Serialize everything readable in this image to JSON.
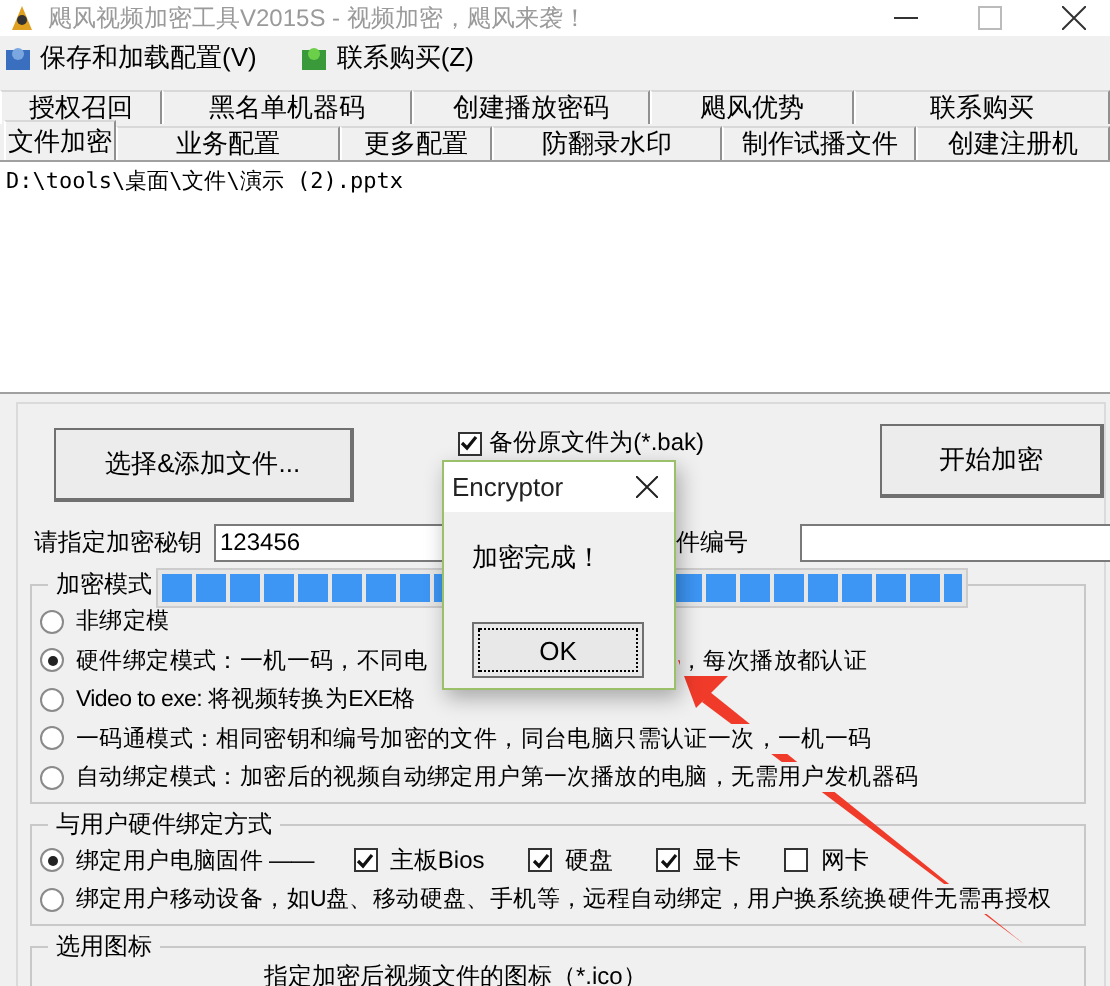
{
  "window": {
    "title": "飓风视频加密工具V2015S - 视频加密，飓风来袭！"
  },
  "menu": [
    {
      "label": "保存和加载配置(V)"
    },
    {
      "label": "联系购买(Z)"
    }
  ],
  "tab_rows": [
    [
      {
        "label": "授权召回",
        "selected": false
      },
      {
        "label": "黑名单机器码",
        "selected": false
      },
      {
        "label": "创建播放密码",
        "selected": false
      },
      {
        "label": "飓风优势",
        "selected": false
      },
      {
        "label": "联系购买",
        "selected": false
      }
    ],
    [
      {
        "label": "文件加密",
        "selected": true
      },
      {
        "label": "业务配置",
        "selected": false
      },
      {
        "label": "更多配置",
        "selected": false
      },
      {
        "label": "防翻录水印",
        "selected": false
      },
      {
        "label": "制作试播文件",
        "selected": false
      },
      {
        "label": "创建注册机",
        "selected": false
      }
    ]
  ],
  "file_list": [
    "D:\\tools\\桌面\\文件\\演示 (2).pptx"
  ],
  "add_button": "选择&添加文件...",
  "backup": {
    "label": "备份原文件为(*.bak)",
    "checked": true
  },
  "start_button": "开始加密",
  "key": {
    "label": "请指定加密秘钥",
    "value": "123456"
  },
  "number": {
    "label": "件编号"
  },
  "mode_group": {
    "title": "加密模式",
    "options": [
      {
        "text": "非绑定模",
        "selected": false
      },
      {
        "text": "硬件绑定模式：一机一码，不同电",
        "tail": "，每次播放都认证",
        "selected": true
      },
      {
        "text": "Video to exe: 将视频转换为EXE格",
        "selected": false
      },
      {
        "text": "一码通模式：相同密钥和编号加密的文件，同台电脑只需认证一次，一机一码",
        "selected": false
      },
      {
        "text": "自动绑定模式：加密后的视频自动绑定用户第一次播放的电脑，无需用户发机器码",
        "selected": false
      }
    ]
  },
  "binding_group": {
    "title": "与用户硬件绑定方式",
    "options": [
      {
        "text": "绑定用户电脑固件 ——",
        "selected": true,
        "parts": [
          {
            "label": "主板Bios",
            "checked": true
          },
          {
            "label": "硬盘",
            "checked": true
          },
          {
            "label": "显卡",
            "checked": true
          },
          {
            "label": "网卡",
            "checked": false
          }
        ]
      },
      {
        "text": "绑定用户移动设备，如U盘、移动硬盘、手机等，远程自动绑定，用户换系统换硬件无需再授权",
        "selected": false
      }
    ]
  },
  "icon_group": {
    "title": "选用图标",
    "hint": "指定加密后视频文件的图标（*.ico）"
  },
  "progress": {
    "level": 1
  },
  "dialog": {
    "title": "Encryptor",
    "message": "加密完成！",
    "button": "OK"
  }
}
